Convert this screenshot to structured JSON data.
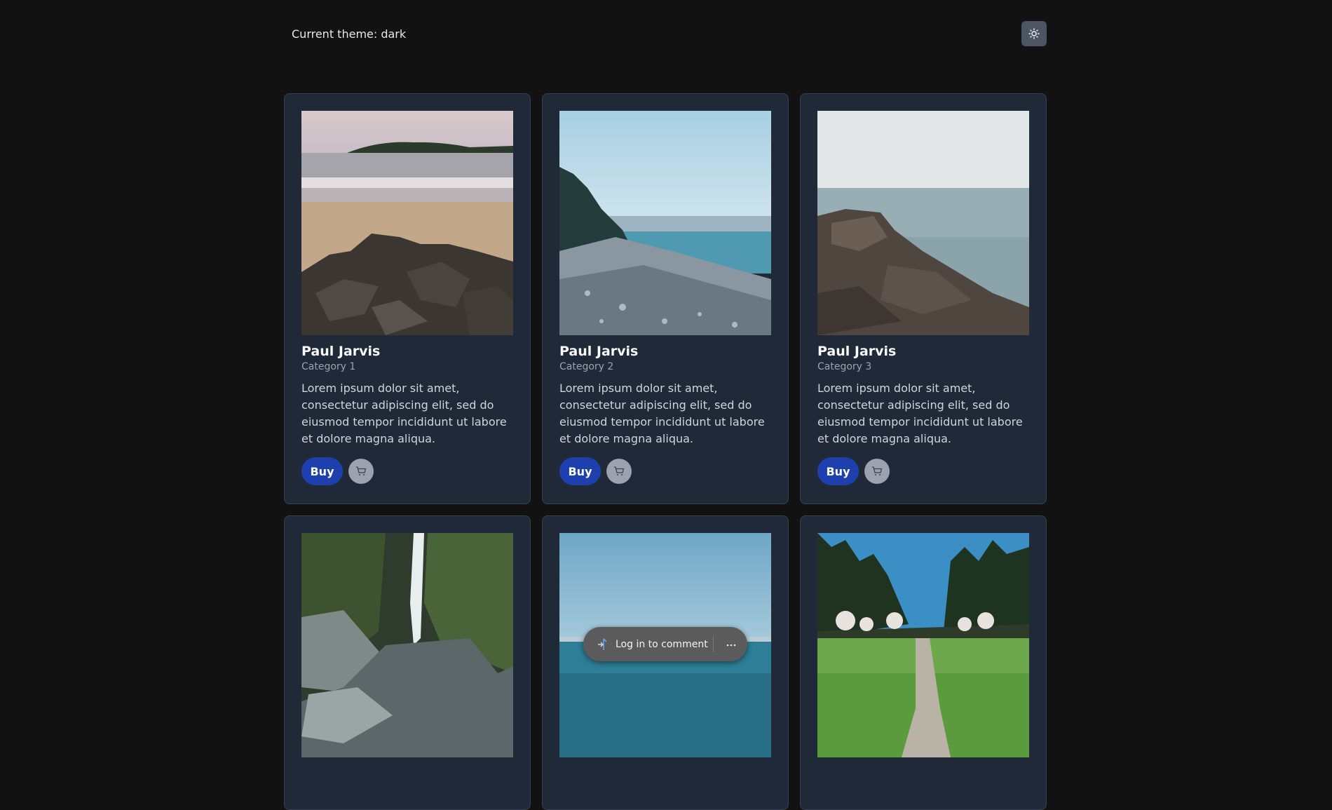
{
  "header": {
    "theme_label": "Current theme: dark",
    "theme_toggle_icon": "sun-icon"
  },
  "cards": [
    {
      "title": "Paul Jarvis",
      "category": "Category 1",
      "description": "Lorem ipsum dolor sit amet, consectetur adipiscing elit, sed do eiusmod tempor incididunt ut labore et dolore magna aliqua.",
      "buy_label": "Buy",
      "image": "beach-rocks-photo"
    },
    {
      "title": "Paul Jarvis",
      "category": "Category 2",
      "description": "Lorem ipsum dolor sit amet, consectetur adipiscing elit, sed do eiusmod tempor incididunt ut labore et dolore magna aliqua.",
      "buy_label": "Buy",
      "image": "pebble-shore-photo"
    },
    {
      "title": "Paul Jarvis",
      "category": "Category 3",
      "description": "Lorem ipsum dolor sit amet, consectetur adipiscing elit, sed do eiusmod tempor incididunt ut labore et dolore magna aliqua.",
      "buy_label": "Buy",
      "image": "rocky-coast-photo"
    },
    {
      "image": "waterfall-photo"
    },
    {
      "image": "ocean-photo"
    },
    {
      "image": "forest-path-photo"
    }
  ],
  "comment_bar": {
    "login_label": "Log in to comment",
    "login_icon": "login-icon",
    "more_icon": "more-icon"
  },
  "colors": {
    "background": "#121212",
    "card": "#1f2937",
    "buy_button": "#1e40af",
    "cart_button": "#9ca3af"
  }
}
